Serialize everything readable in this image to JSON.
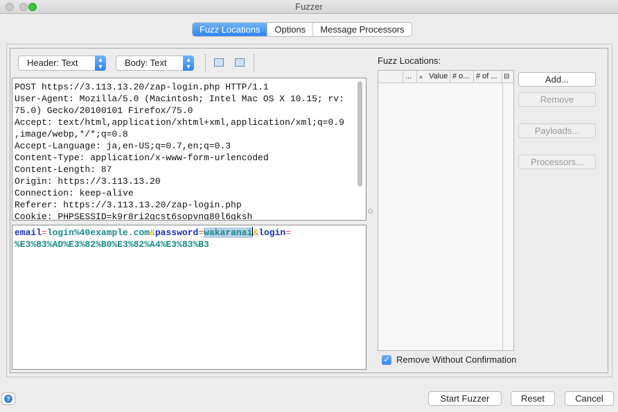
{
  "window": {
    "title": "Fuzzer"
  },
  "tabs": [
    {
      "label": "Fuzz Locations",
      "active": true
    },
    {
      "label": "Options",
      "active": false
    },
    {
      "label": "Message Processors",
      "active": false
    }
  ],
  "toolbar": {
    "header_view": "Header: Text",
    "body_view": "Body: Text"
  },
  "request": {
    "header_lines": [
      "POST https://3.113.13.20/zap-login.php HTTP/1.1",
      "User-Agent: Mozilla/5.0 (Macintosh; Intel Mac OS X 10.15; rv:",
      "75.0) Gecko/20100101 Firefox/75.0",
      "Accept: text/html,application/xhtml+xml,application/xml;q=0.9",
      ",image/webp,*/*;q=0.8",
      "Accept-Language: ja,en-US;q=0.7,en;q=0.3",
      "Content-Type: application/x-www-form-urlencoded",
      "Content-Length: 87",
      "Origin: https://3.113.13.20",
      "Connection: keep-alive",
      "Referer: https://3.113.13.20/zap-login.php",
      "Cookie: PHPSESSID=k9r8ri2gcst6sopvnq80l6gksh"
    ],
    "body": {
      "k1": "email",
      "eq1": "=",
      "v1": "login%40example.com",
      "amp1": "&",
      "k2": "password",
      "eq2": "=",
      "v2_selected": "wakaranai",
      "amp2": "&",
      "k3": "login",
      "eq3": "=",
      "v3": "%E3%83%AD%E3%82%B0%E3%82%A4%E3%83%B3"
    }
  },
  "fuzz_locations": {
    "label": "Fuzz Locations:",
    "columns": [
      "...",
      "",
      "Value",
      "# o...",
      "# of ..."
    ],
    "buttons": {
      "add": "Add...",
      "remove": "Remove",
      "payloads": "Payloads...",
      "processors": "Processors..."
    },
    "remove_without_confirmation": {
      "label": "Remove Without Confirmation",
      "checked": true
    }
  },
  "footer": {
    "help_icon": "help-icon",
    "start": "Start Fuzzer",
    "reset": "Reset",
    "cancel": "Cancel"
  },
  "colors": {
    "accent": "#2f86ee",
    "param_key": "#1a2fb8",
    "param_value": "#1a8a8a",
    "equals": "#e0455a",
    "ampersand": "#d49a00",
    "selection": "#b6cfe8"
  }
}
